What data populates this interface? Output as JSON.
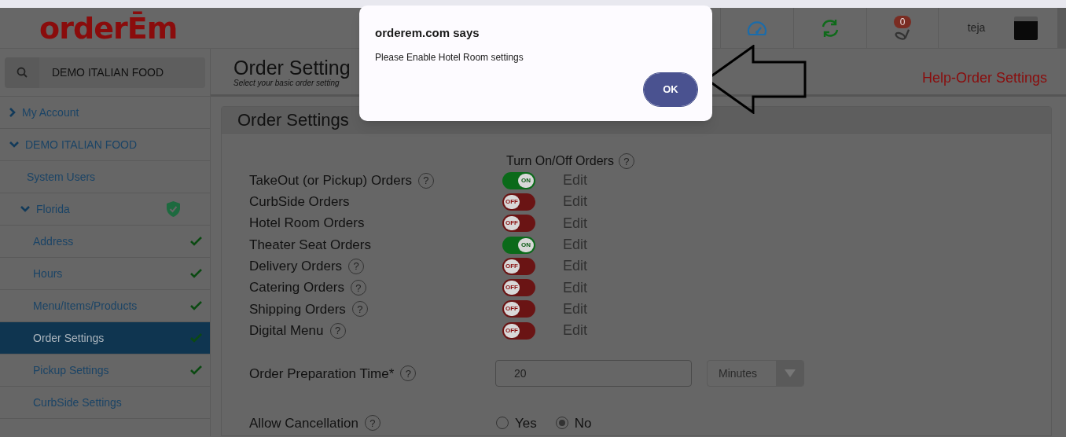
{
  "header": {
    "logo": "orderĒm",
    "notification_count": "0",
    "user_name": "teja"
  },
  "sidebar": {
    "search_value": "DEMO ITALIAN FOOD",
    "items": [
      {
        "label": "My Account",
        "expanded": false,
        "selected": false
      },
      {
        "label": "DEMO ITALIAN FOOD",
        "expanded": true,
        "selected": false,
        "children": [
          {
            "label": "System Users",
            "selected": false
          },
          {
            "label": "Florida",
            "expanded": true,
            "verified": true,
            "selected": false,
            "children": [
              {
                "label": "Address",
                "complete": true,
                "selected": false
              },
              {
                "label": "Hours",
                "complete": true,
                "selected": false
              },
              {
                "label": "Menu/Items/Products",
                "complete": true,
                "selected": false
              },
              {
                "label": "Order Settings",
                "complete": true,
                "selected": true
              },
              {
                "label": "Pickup Settings",
                "complete": true,
                "selected": false
              },
              {
                "label": "CurbSide Settings",
                "complete": false,
                "selected": false
              }
            ]
          }
        ]
      }
    ]
  },
  "page": {
    "title": "Order Setting",
    "subtitle": "Select your basic order setting",
    "help_link": "Help-Order Settings"
  },
  "panel": {
    "title": "Order Settings",
    "toggle_header": "Turn On/Off Orders",
    "toggle_header_help": "?",
    "orders": [
      {
        "label": "TakeOut (or Pickup) Orders",
        "help": "?",
        "on": true,
        "switch_label": "ON",
        "edit": "Edit"
      },
      {
        "label": "CurbSide Orders",
        "on": false,
        "switch_label": "OFF",
        "edit": "Edit"
      },
      {
        "label": "Hotel Room Orders",
        "on": false,
        "switch_label": "OFF",
        "edit": "Edit"
      },
      {
        "label": "Theater Seat Orders",
        "on": true,
        "switch_label": "ON",
        "edit": "Edit"
      },
      {
        "label": "Delivery Orders",
        "help": "?",
        "on": false,
        "switch_label": "OFF",
        "edit": "Edit"
      },
      {
        "label": "Catering Orders",
        "help": "?",
        "on": false,
        "switch_label": "OFF",
        "edit": "Edit"
      },
      {
        "label": "Shipping Orders",
        "help": "?",
        "on": false,
        "switch_label": "OFF",
        "edit": "Edit"
      },
      {
        "label": "Digital Menu",
        "help": "?",
        "on": false,
        "switch_label": "OFF",
        "edit": "Edit"
      }
    ],
    "prep_time": {
      "label": "Order Preparation Time*",
      "help": "?",
      "value": "20",
      "unit": "Minutes"
    },
    "cancellation": {
      "label": "Allow Cancellation",
      "help": "?",
      "options": [
        {
          "label": "Yes",
          "selected": false
        },
        {
          "label": "No",
          "selected": true
        }
      ]
    }
  },
  "dialog": {
    "title": "orderem.com says",
    "message": "Please Enable Hotel Room settings",
    "button": "OK"
  }
}
